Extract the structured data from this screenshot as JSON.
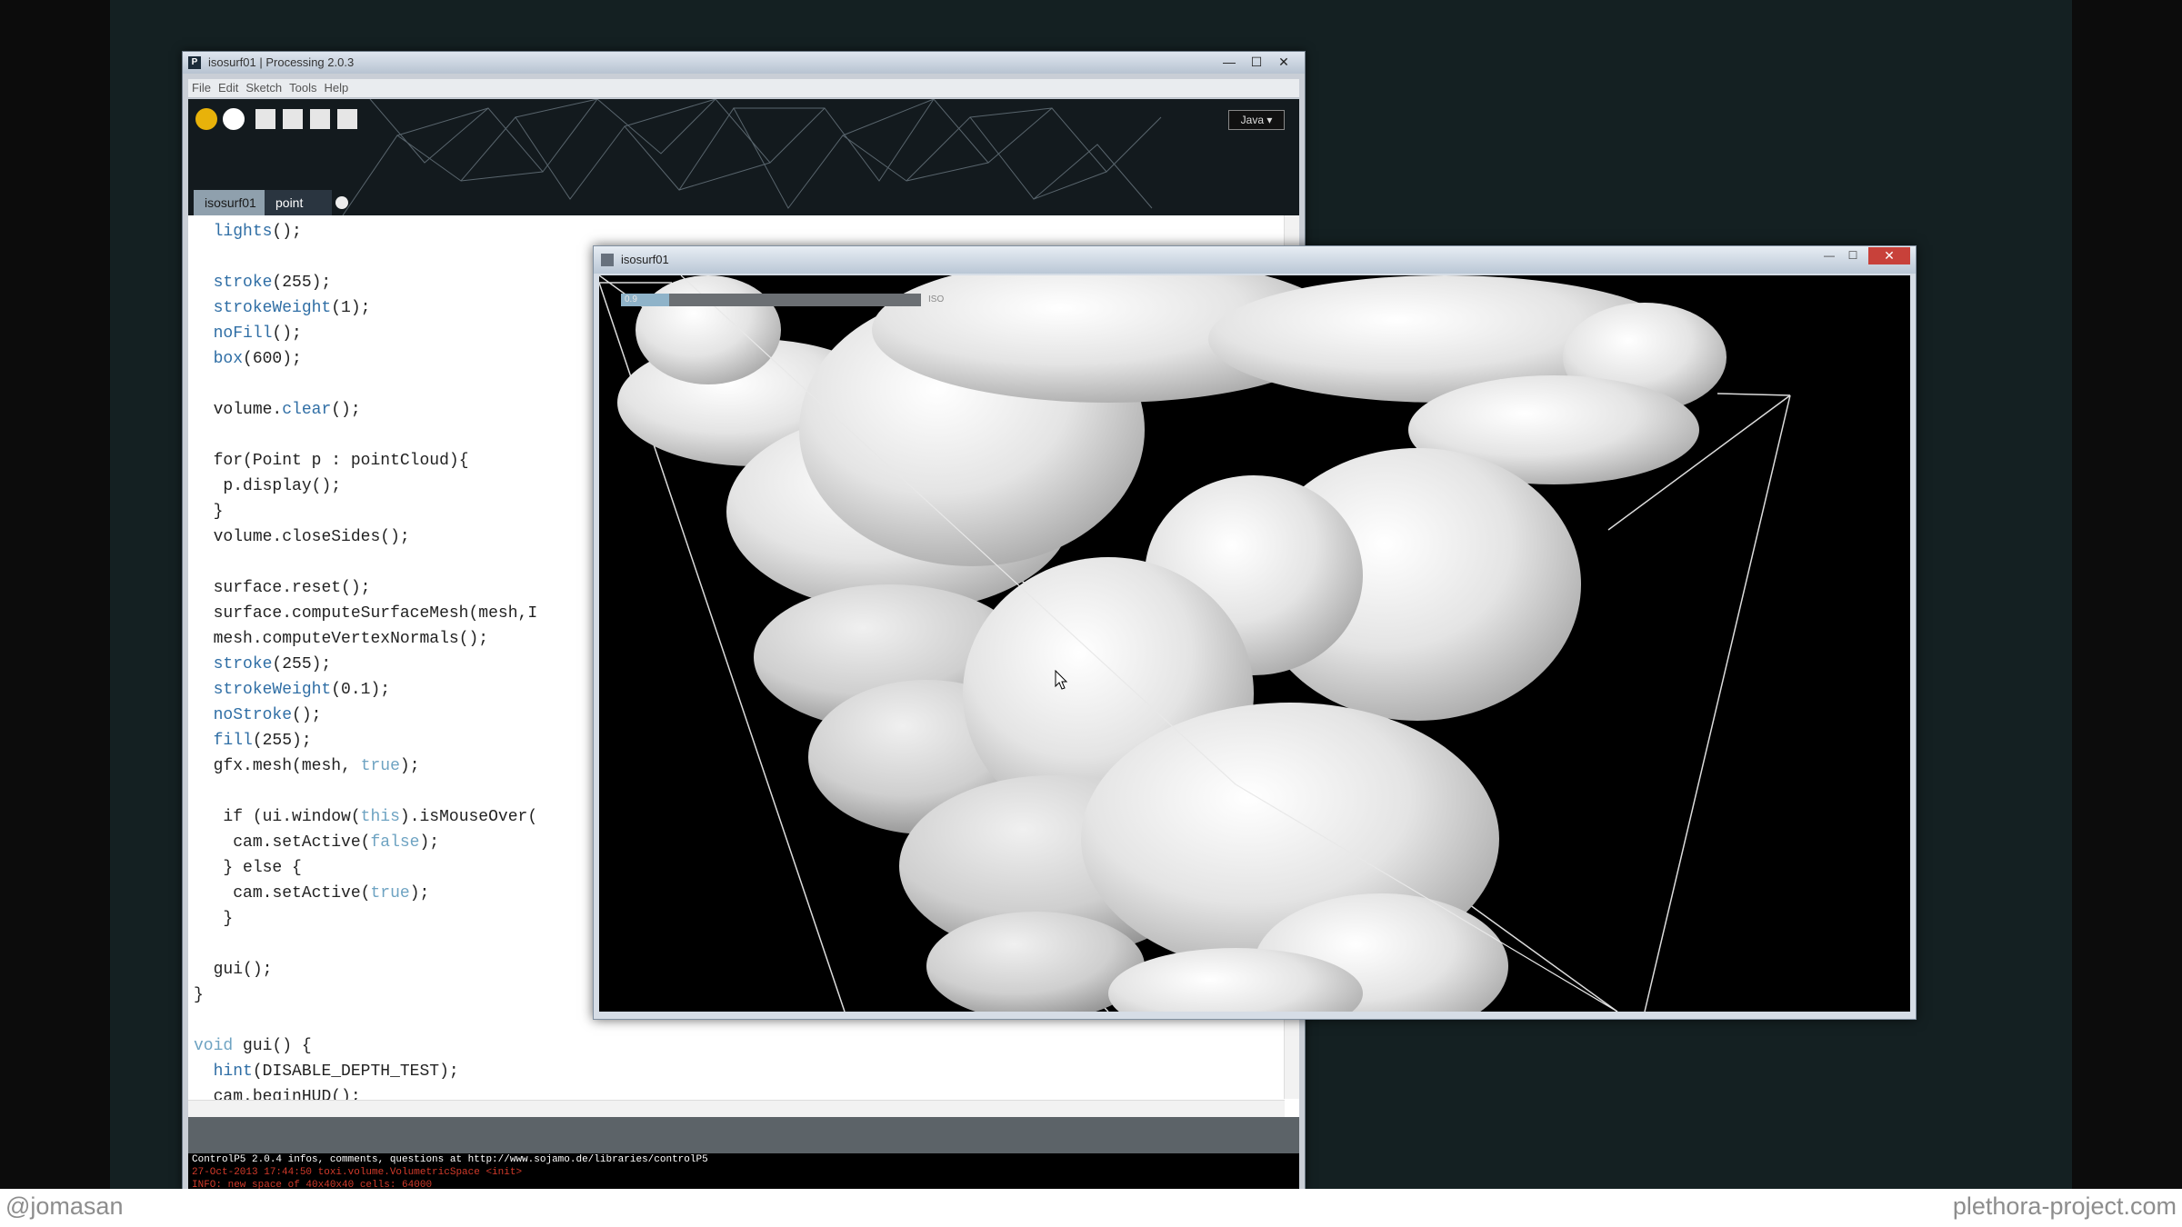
{
  "ide": {
    "window_title": "isosurf01 | Processing 2.0.3",
    "app_icon_letter": "P",
    "controls": {
      "minimize": "—",
      "maximize": "☐",
      "close": "✕"
    },
    "menu": [
      "File",
      "Edit",
      "Sketch",
      "Tools",
      "Help"
    ],
    "mode": "Java ▾",
    "tabs": [
      {
        "label": "isosurf01"
      },
      {
        "label": "point"
      }
    ],
    "code_lines": [
      "  lights();",
      "",
      "  stroke(255);",
      "  strokeWeight(1);",
      "  noFill();",
      "  box(600);",
      "",
      "  volume.clear();",
      "",
      "  for(Point p : pointCloud){",
      "   p.display();",
      "  }",
      "  volume.closeSides();",
      "",
      "  surface.reset();",
      "  surface.computeSurfaceMesh(mesh,I",
      "  mesh.computeVertexNormals();",
      "  stroke(255);",
      "  strokeWeight(0.1);",
      "  noStroke();",
      "  fill(255);",
      "  gfx.mesh(mesh, true);",
      "",
      "   if (ui.window(this).isMouseOver(",
      "    cam.setActive(false);",
      "   } else {",
      "    cam.setActive(true);",
      "   }",
      "",
      "  gui();",
      "}",
      "",
      "void gui() {",
      "  hint(DISABLE_DEPTH_TEST);",
      "  cam.beginHUD();"
    ],
    "console": [
      {
        "text": "ControlP5 2.0.4 infos, comments, questions at http://www.sojamo.de/libraries/controlP5",
        "color": "white"
      },
      {
        "text": "27-Oct-2013 17:44:50 toxi.volume.VolumetricSpace <init>",
        "color": "red"
      },
      {
        "text": "INFO: new space of 40x40x40 cells: 64000",
        "color": "red"
      }
    ]
  },
  "sketch": {
    "window_title": "isosurf01",
    "controls": {
      "minimize": "—",
      "maximize": "☐",
      "close": "✕"
    },
    "slider": {
      "value_text": "0.9",
      "fill_fraction": 0.16,
      "label": "ISO"
    }
  },
  "footer": {
    "left": "@jomasan",
    "right": "plethora-project.com"
  },
  "colors": {
    "play": "#e8b20a",
    "keyword": "#2f6ea5",
    "literal": "#6ea3c2",
    "console_red": "#d23a2a"
  },
  "icons": [
    "play-icon",
    "stop-icon",
    "new-icon",
    "open-icon",
    "save-icon",
    "export-icon",
    "cursor-icon"
  ]
}
